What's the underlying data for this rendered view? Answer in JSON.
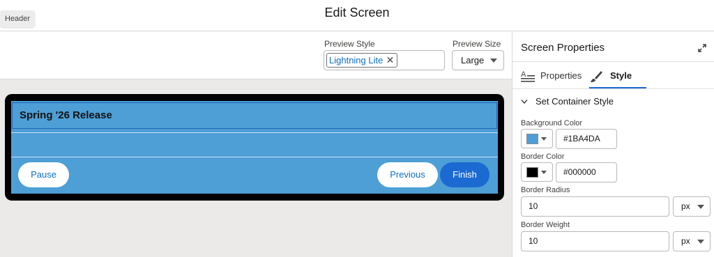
{
  "header": {
    "tag_label": "Header",
    "title": "Edit Screen"
  },
  "preview": {
    "style_label": "Preview Style",
    "style_value": "Lightning Lite",
    "size_label": "Preview Size",
    "size_value": "Large"
  },
  "screen": {
    "header_text": "Spring '26 Release",
    "pause_label": "Pause",
    "previous_label": "Previous",
    "finish_label": "Finish",
    "background_color": "#4D9FD6",
    "border_color": "#000000",
    "finish_color": "#1B6AD1"
  },
  "panel": {
    "title": "Screen Properties",
    "tabs": [
      {
        "label": "Properties",
        "icon": "properties-icon"
      },
      {
        "label": "Style",
        "icon": "paintbrush-icon"
      }
    ],
    "section_title": "Set Container Style",
    "background_color_label": "Background Color",
    "background_color_value": "#1BA4DA",
    "border_color_label": "Border Color",
    "border_color_value": "#000000",
    "border_radius_label": "Border Radius",
    "border_radius_value": "10",
    "border_radius_unit": "px",
    "border_weight_label": "Border Weight",
    "border_weight_value": "10",
    "border_weight_unit": "px"
  }
}
